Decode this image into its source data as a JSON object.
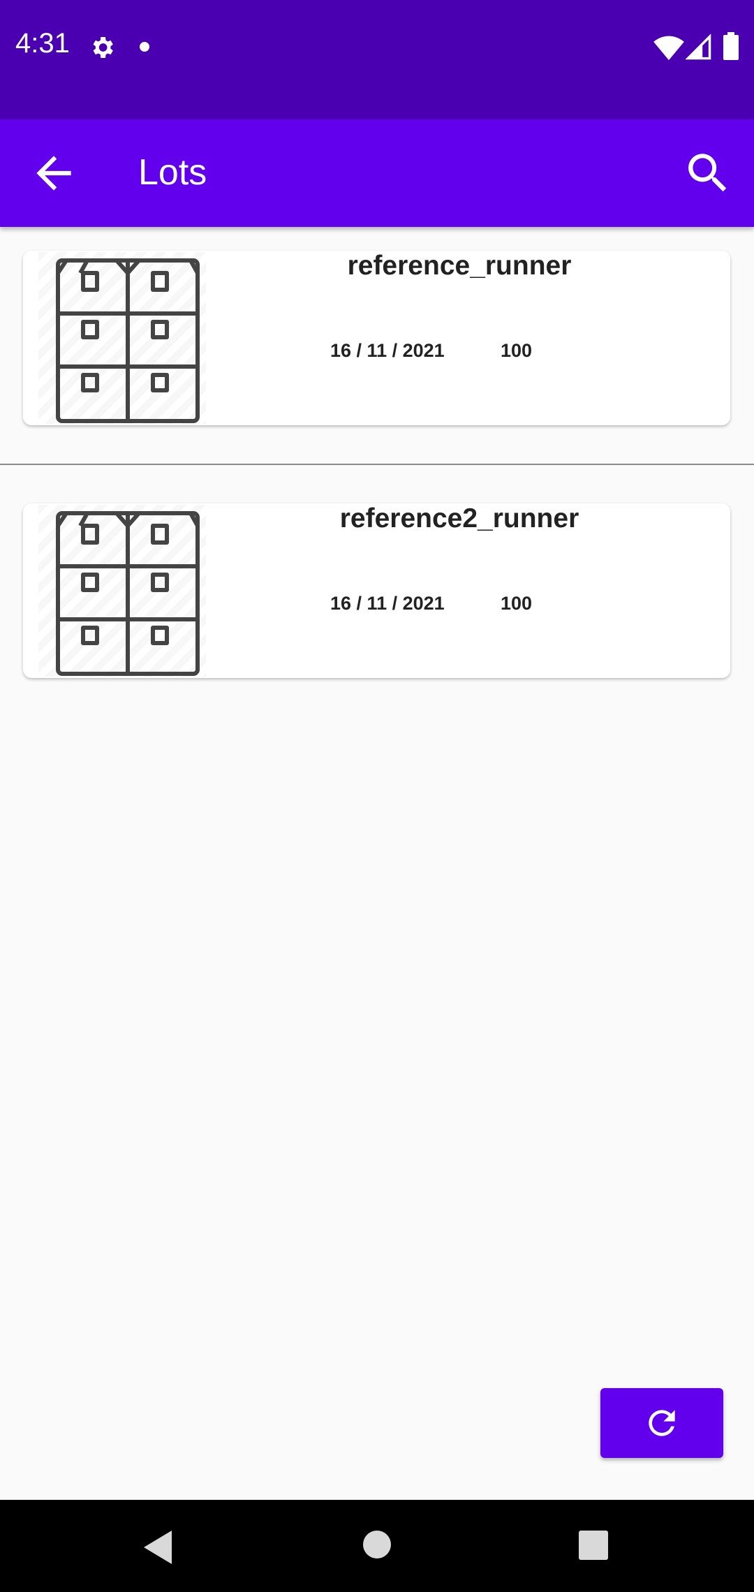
{
  "status_bar": {
    "time": "4:31",
    "icons": [
      "gear-icon",
      "dot-icon",
      "wifi-icon",
      "signal-icon",
      "battery-icon"
    ]
  },
  "app_bar": {
    "title": "Lots",
    "back_icon": "arrow-left-icon",
    "search_icon": "search-icon"
  },
  "lots": [
    {
      "name": "reference_runner",
      "date": "16 / 11 / 2021",
      "quantity": "100",
      "icon": "boxes-icon"
    },
    {
      "name": "reference2_runner",
      "date": "16 / 11 / 2021",
      "quantity": "100",
      "icon": "boxes-icon"
    }
  ],
  "fab": {
    "icon": "refresh-icon"
  },
  "nav_bar": {
    "icons": [
      "nav-back-icon",
      "nav-home-icon",
      "nav-recents-icon"
    ]
  },
  "colors": {
    "status_bar": "#4a00b0",
    "primary": "#6200ee",
    "background": "#fafafa"
  }
}
